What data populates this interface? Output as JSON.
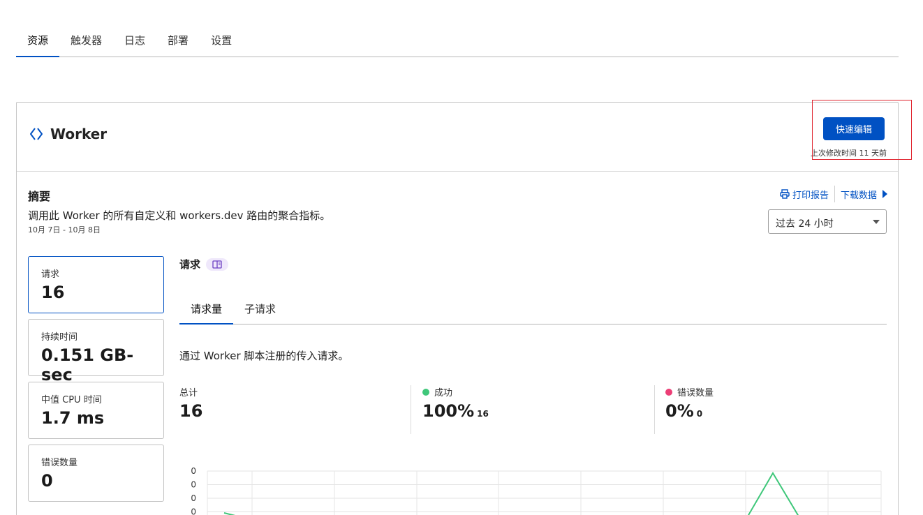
{
  "top_tabs": [
    {
      "label": "资源",
      "active": true
    },
    {
      "label": "触发器",
      "active": false
    },
    {
      "label": "日志",
      "active": false
    },
    {
      "label": "部署",
      "active": false
    },
    {
      "label": "设置",
      "active": false
    }
  ],
  "header": {
    "title": "Worker",
    "quick_edit_label": "快速编辑",
    "last_modified": "上次修改时间 11 天前"
  },
  "summary": {
    "title": "摘要",
    "description": "调用此 Worker 的所有自定义和 workers.dev 路由的聚合指标。",
    "date_range": "10月 7日 - 10月 8日",
    "print_label": "打印报告",
    "download_label": "下载数据",
    "time_range": "过去 24 小时"
  },
  "tiles": [
    {
      "label": "请求",
      "value": "16"
    },
    {
      "label": "持续时间",
      "value": "0.151 GB-sec"
    },
    {
      "label": "中值 CPU 时间",
      "value": "1.7 ms"
    },
    {
      "label": "错误数量",
      "value": "0"
    }
  ],
  "requests": {
    "title": "请求",
    "tabs": [
      "请求量",
      "子请求"
    ],
    "description": "通过 Worker 脚本注册的传入请求。",
    "total_label": "总计",
    "total_value": "16",
    "success_label": "成功",
    "success_value": "100%",
    "success_count": "16",
    "error_label": "错误数量",
    "error_value": "0%",
    "error_count": "0"
  },
  "colors": {
    "accent": "#0051c3",
    "success": "#3fc77a",
    "error": "#ec3e76"
  },
  "chart_data": {
    "type": "line",
    "y_tick_labels": [
      "0",
      "0",
      "0",
      "0"
    ],
    "series": [
      {
        "values": [
          0.5,
          0,
          0,
          0,
          0,
          0,
          0,
          0,
          1,
          0
        ]
      }
    ],
    "grid": true
  }
}
